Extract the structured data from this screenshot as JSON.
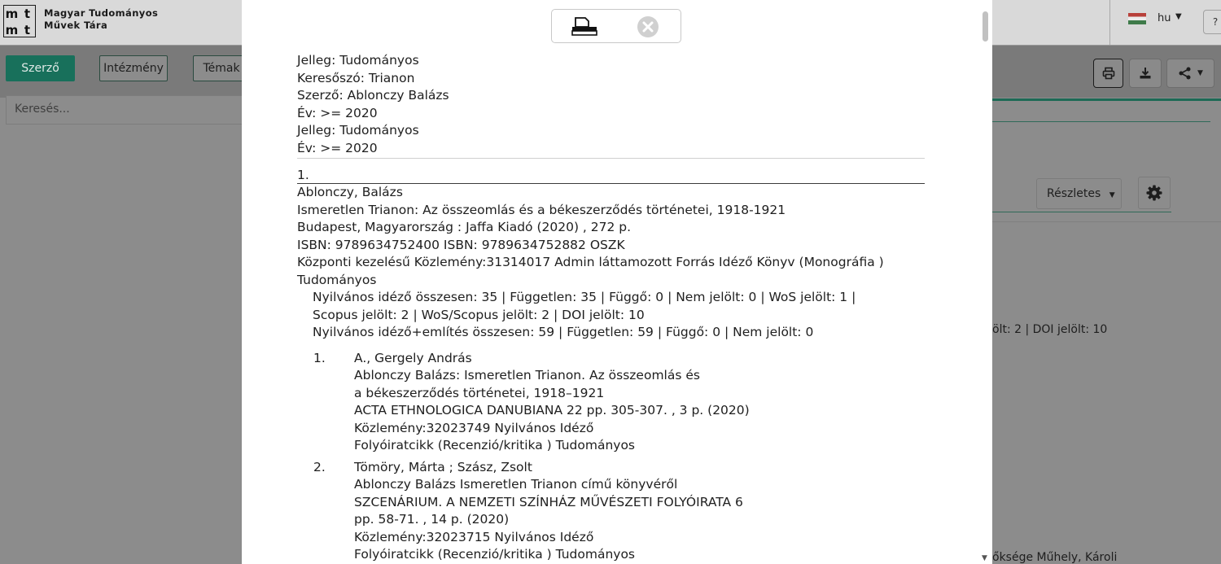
{
  "app": {
    "logo_cells": [
      "m",
      "t",
      "m",
      "t"
    ],
    "logo_line1": "Magyar Tudományos",
    "logo_line2": "Művek Tára",
    "language": "hu",
    "help": "?"
  },
  "tabs": [
    {
      "label": "Szerző"
    },
    {
      "label": "Intézmény"
    },
    {
      "label": "Témak"
    }
  ],
  "search": {
    "placeholder": "Keresés..."
  },
  "bg_panel": {
    "view_select": "Részletes",
    "fragment1": "ölt: 2 | DOI jelölt: 10",
    "fragment2": "őksége Műhely, Károli"
  },
  "colors": {
    "accent": "#18705b",
    "overlay": "#8c8c8c"
  },
  "icons": [
    "printer-icon",
    "close-icon",
    "print-icon",
    "download-icon",
    "share-icon",
    "gear-icon",
    "chevron-down-icon"
  ],
  "modal": {
    "filters": [
      "Jelleg: Tudományos",
      "Keresőszó: Trianon",
      "Szerző: Ablonczy Balázs",
      "Év: >= 2020",
      "Jelleg: Tudományos",
      "Év: >= 2020"
    ],
    "record": {
      "number": "1.",
      "author": "Ablonczy, Balázs",
      "title": "Ismeretlen Trianon: Az összeomlás és a békeszerződés történetei, 1918-1921",
      "publisher": "Budapest, Magyarország : Jaffa Kiadó (2020) , 272 p.",
      "isbn": "ISBN: 9789634752400 ISBN: 9789634752882 OSZK",
      "meta": "Központi kezelésű Közlemény:31314017 Admin láttamozott Forrás Idéző Könyv (Monográfia )",
      "type": "Tudományos",
      "citations_summary": "Nyilvános idéző összesen: 35 | Független: 35 | Függő: 0 | Nem jelölt: 0 | WoS jelölt: 1 | Scopus jelölt: 2 | WoS/Scopus jelölt: 2 | DOI jelölt: 10",
      "mentions_summary": "Nyilvános idéző+említés összesen: 59 | Független: 59 | Függő: 0 | Nem jelölt: 0",
      "citations": [
        {
          "num": "1.",
          "author": "A., Gergely András",
          "title": "Ablonczy Balázs: Ismeretlen Trianon. Az összeomlás és a békeszerződés történetei, 1918–1921",
          "source": "ACTA ETHNOLOGICA DANUBIANA 22 pp. 305-307. , 3 p. (2020)",
          "meta": "Közlemény:32023749 Nyilvános Idéző Folyóiratcikk (Recenzió/kritika ) Tudományos"
        },
        {
          "num": "2.",
          "author": "Tömöry, Márta ; Szász, Zsolt",
          "title": "Ablonczy Balázs Ismeretlen Trianon című könyvéről",
          "source": "SZCENÁRIUM. A NEMZETI SZÍNHÁZ MŰVÉSZETI FOLYÓIRATA 6 pp. 58-71. , 14 p. (2020)",
          "meta": "Közlemény:32023715 Nyilvános Idéző Folyóiratcikk (Recenzió/kritika ) Tudományos"
        }
      ]
    }
  }
}
